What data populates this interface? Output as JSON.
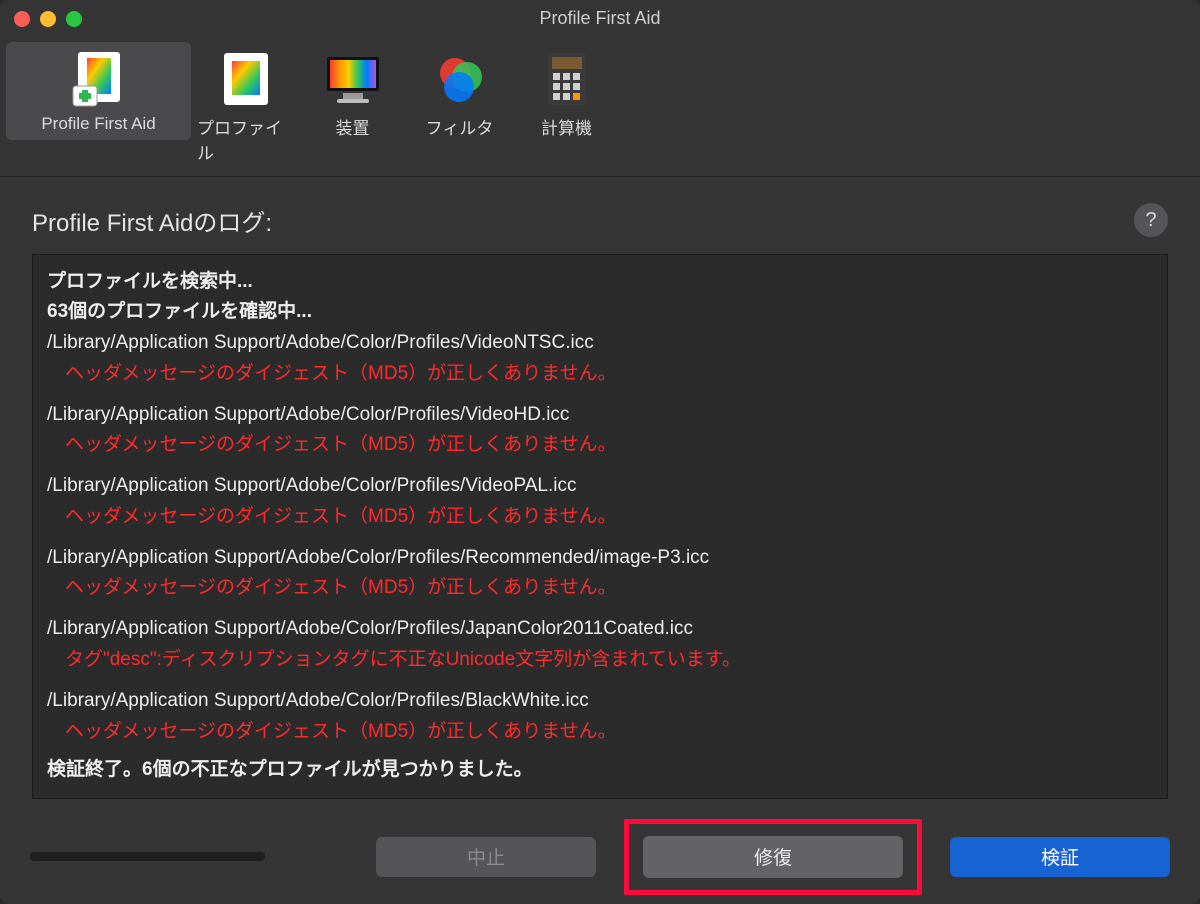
{
  "window": {
    "title": "Profile First Aid"
  },
  "toolbar": {
    "items": [
      {
        "label": "Profile First Aid"
      },
      {
        "label": "プロファイル"
      },
      {
        "label": "装置"
      },
      {
        "label": "フィルタ"
      },
      {
        "label": "計算機"
      }
    ]
  },
  "log": {
    "header": "Profile First Aidのログ:",
    "help_glyph": "?",
    "lines": {
      "searching": "プロファイルを検索中...",
      "checking": "63個のプロファイルを確認中...",
      "entries": [
        {
          "path": "/Library/Application Support/Adobe/Color/Profiles/VideoNTSC.icc",
          "error": "ヘッダメッセージのダイジェスト（MD5）が正しくありません。"
        },
        {
          "path": "/Library/Application Support/Adobe/Color/Profiles/VideoHD.icc",
          "error": "ヘッダメッセージのダイジェスト（MD5）が正しくありません。"
        },
        {
          "path": "/Library/Application Support/Adobe/Color/Profiles/VideoPAL.icc",
          "error": "ヘッダメッセージのダイジェスト（MD5）が正しくありません。"
        },
        {
          "path": "/Library/Application Support/Adobe/Color/Profiles/Recommended/image-P3.icc",
          "error": "ヘッダメッセージのダイジェスト（MD5）が正しくありません。"
        },
        {
          "path": "/Library/Application Support/Adobe/Color/Profiles/JapanColor2011Coated.icc",
          "error": "タグ\"desc\":ディスクリプションタグに不正なUnicode文字列が含まれています。"
        },
        {
          "path": "/Library/Application Support/Adobe/Color/Profiles/BlackWhite.icc",
          "error": "ヘッダメッセージのダイジェスト（MD5）が正しくありません。"
        }
      ],
      "done": "検証終了。6個の不正なプロファイルが見つかりました。"
    }
  },
  "buttons": {
    "stop": "中止",
    "repair": "修復",
    "verify": "検証"
  }
}
